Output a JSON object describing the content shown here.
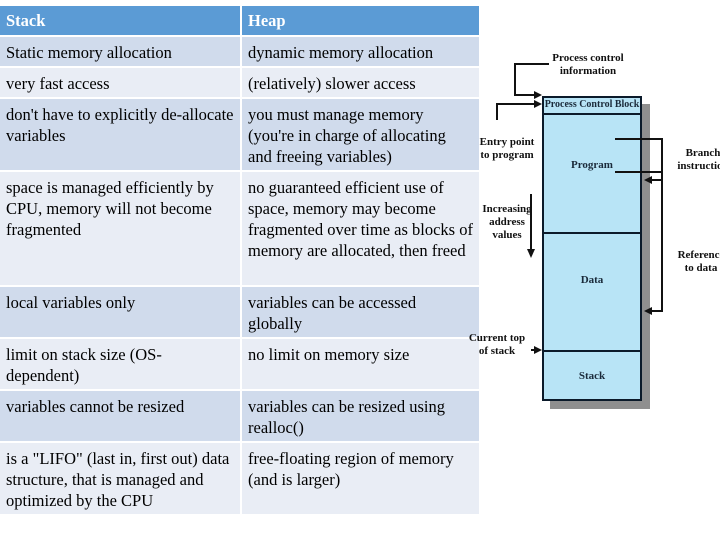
{
  "table": {
    "headers": [
      "Stack",
      "Heap"
    ],
    "rows": [
      [
        "Static memory allocation",
        "dynamic memory allocation"
      ],
      [
        "very fast access",
        "(relatively) slower access"
      ],
      [
        "don't have to explicitly de-allocate variables",
        "you must manage memory (you're in charge of allocating and freeing variables)"
      ],
      [
        "space is managed efficiently by CPU, memory will not become fragmented",
        "no guaranteed efficient use of space, memory may become fragmented over time as blocks of memory are allocated, then freed"
      ],
      [
        "local variables only",
        "variables can be accessed globally"
      ],
      [
        "limit on stack size (OS-dependent)",
        "no limit on memory size"
      ],
      [
        "variables cannot be resized",
        "variables can be resized using realloc()"
      ],
      [
        "is a \"LIFO\" (last in, first out) data structure, that is managed and optimized by the CPU",
        "free-floating region of memory (and is larger)"
      ]
    ]
  },
  "diagram": {
    "labels": {
      "process_control_info_line1": "Process control",
      "process_control_info_line2": "information",
      "entry_point_line1": "Entry point",
      "entry_point_line2": "to program",
      "increasing_line1": "Increasing",
      "increasing_line2": "address",
      "increasing_line3": "values",
      "current_top_line1": "Current top",
      "current_top_line2": "of stack",
      "branch_line1": "Branch",
      "branch_line2": "instruction",
      "reference_line1": "Reference",
      "reference_line2": "to data"
    },
    "sections": {
      "pcb": "Process Control Block",
      "program": "Program",
      "data": "Data",
      "stack": "Stack"
    },
    "colors": {
      "box_fill": "#b8e4f6",
      "header_fill": "#5b9bd5",
      "row_odd": "#d0dbec",
      "row_even": "#e9edf5"
    }
  }
}
